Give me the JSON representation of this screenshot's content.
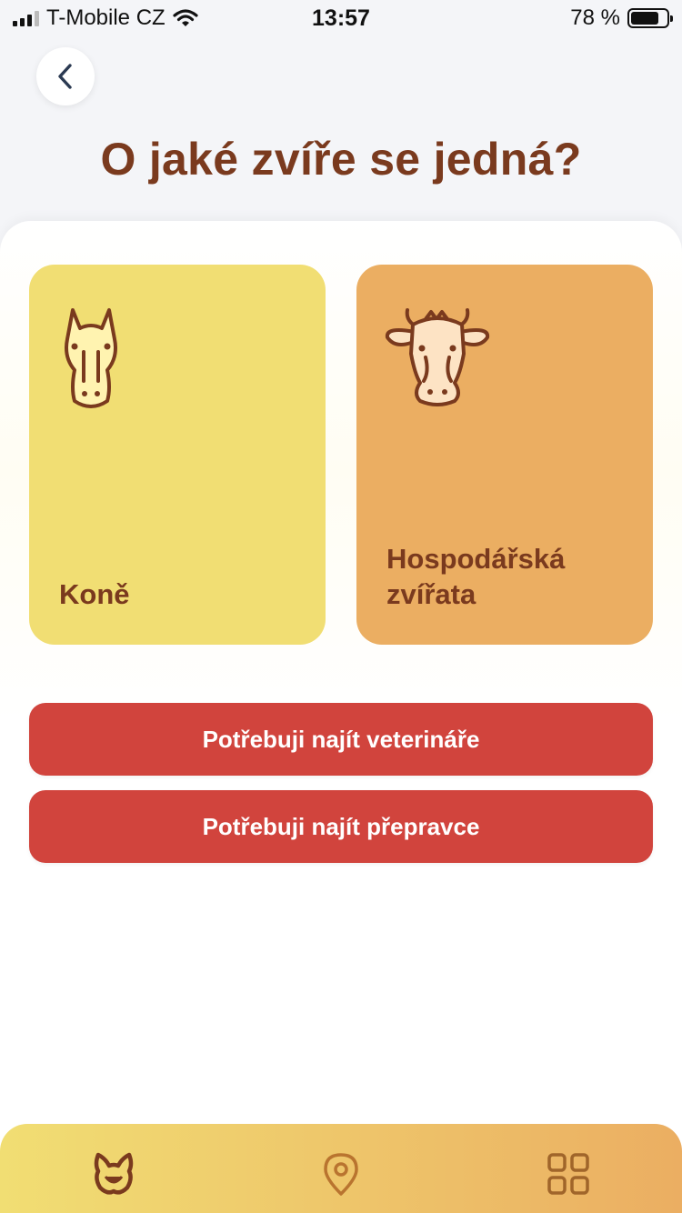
{
  "status_bar": {
    "carrier": "T-Mobile CZ",
    "time": "13:57",
    "battery_percent": "78 %",
    "battery_level": 0.78
  },
  "header": {
    "title": "O jaké zvíře se jedná?",
    "back_icon": "chevron-left-icon"
  },
  "categories": [
    {
      "label": "Koně",
      "icon": "horse-head-icon",
      "color": "#f1de73"
    },
    {
      "label": "Hospodářská zvířata",
      "icon": "cow-head-icon",
      "color": "#ebae62"
    }
  ],
  "actions": {
    "find_vet": "Potřebuji najít veterináře",
    "find_transport": "Potřebuji najít přepravce",
    "color": "#d1443d"
  },
  "bottom_nav": {
    "items": [
      {
        "icon": "pets-icon",
        "active": true
      },
      {
        "icon": "map-pin-icon",
        "active": false
      },
      {
        "icon": "grid-icon",
        "active": false
      }
    ]
  },
  "colors": {
    "title": "#7a3a1e",
    "background": "#f4f5f8"
  }
}
